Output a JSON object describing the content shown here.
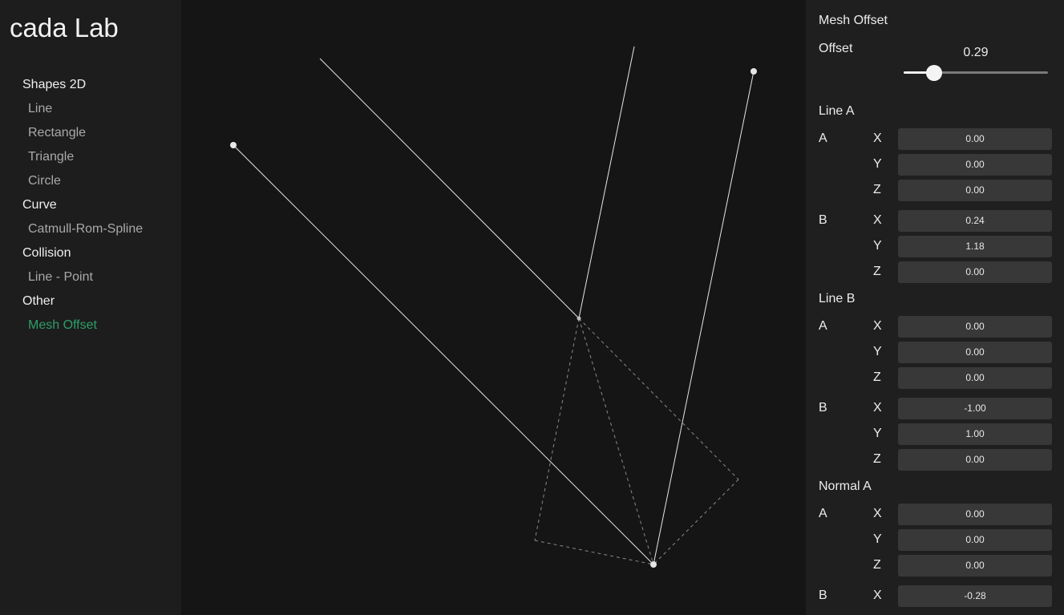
{
  "app": {
    "title": "cada Lab"
  },
  "nav": [
    {
      "group": "Shapes 2D",
      "items": [
        {
          "label": "Line"
        },
        {
          "label": "Rectangle"
        },
        {
          "label": "Triangle"
        },
        {
          "label": "Circle"
        }
      ]
    },
    {
      "group": "Curve",
      "items": [
        {
          "label": "Catmull-Rom-Spline"
        }
      ]
    },
    {
      "group": "Collision",
      "items": [
        {
          "label": "Line - Point"
        }
      ]
    },
    {
      "group": "Other",
      "items": [
        {
          "label": "Mesh Offset",
          "active": true
        }
      ]
    }
  ],
  "panel": {
    "title": "Mesh Offset",
    "offset": {
      "label": "Offset",
      "value": "0.29",
      "fraction": 0.21
    },
    "sections": [
      {
        "title": "Line A",
        "points": [
          {
            "label": "A",
            "coords": [
              {
                "axis": "X",
                "value": "0.00"
              },
              {
                "axis": "Y",
                "value": "0.00"
              },
              {
                "axis": "Z",
                "value": "0.00"
              }
            ]
          },
          {
            "label": "B",
            "coords": [
              {
                "axis": "X",
                "value": "0.24"
              },
              {
                "axis": "Y",
                "value": "1.18"
              },
              {
                "axis": "Z",
                "value": "0.00"
              }
            ]
          }
        ]
      },
      {
        "title": "Line B",
        "points": [
          {
            "label": "A",
            "coords": [
              {
                "axis": "X",
                "value": "0.00"
              },
              {
                "axis": "Y",
                "value": "0.00"
              },
              {
                "axis": "Z",
                "value": "0.00"
              }
            ]
          },
          {
            "label": "B",
            "coords": [
              {
                "axis": "X",
                "value": "-1.00"
              },
              {
                "axis": "Y",
                "value": "1.00"
              },
              {
                "axis": "Z",
                "value": "0.00"
              }
            ]
          }
        ]
      },
      {
        "title": "Normal A",
        "points": [
          {
            "label": "A",
            "coords": [
              {
                "axis": "X",
                "value": "0.00"
              },
              {
                "axis": "Y",
                "value": "0.00"
              },
              {
                "axis": "Z",
                "value": "0.00"
              }
            ]
          },
          {
            "label": "B",
            "coords": [
              {
                "axis": "X",
                "value": "-0.28"
              }
            ]
          }
        ]
      }
    ]
  },
  "colors": {
    "accent": "#2e9e6a",
    "line": "#e6e6e6",
    "dashed": "#8a8a8a"
  }
}
